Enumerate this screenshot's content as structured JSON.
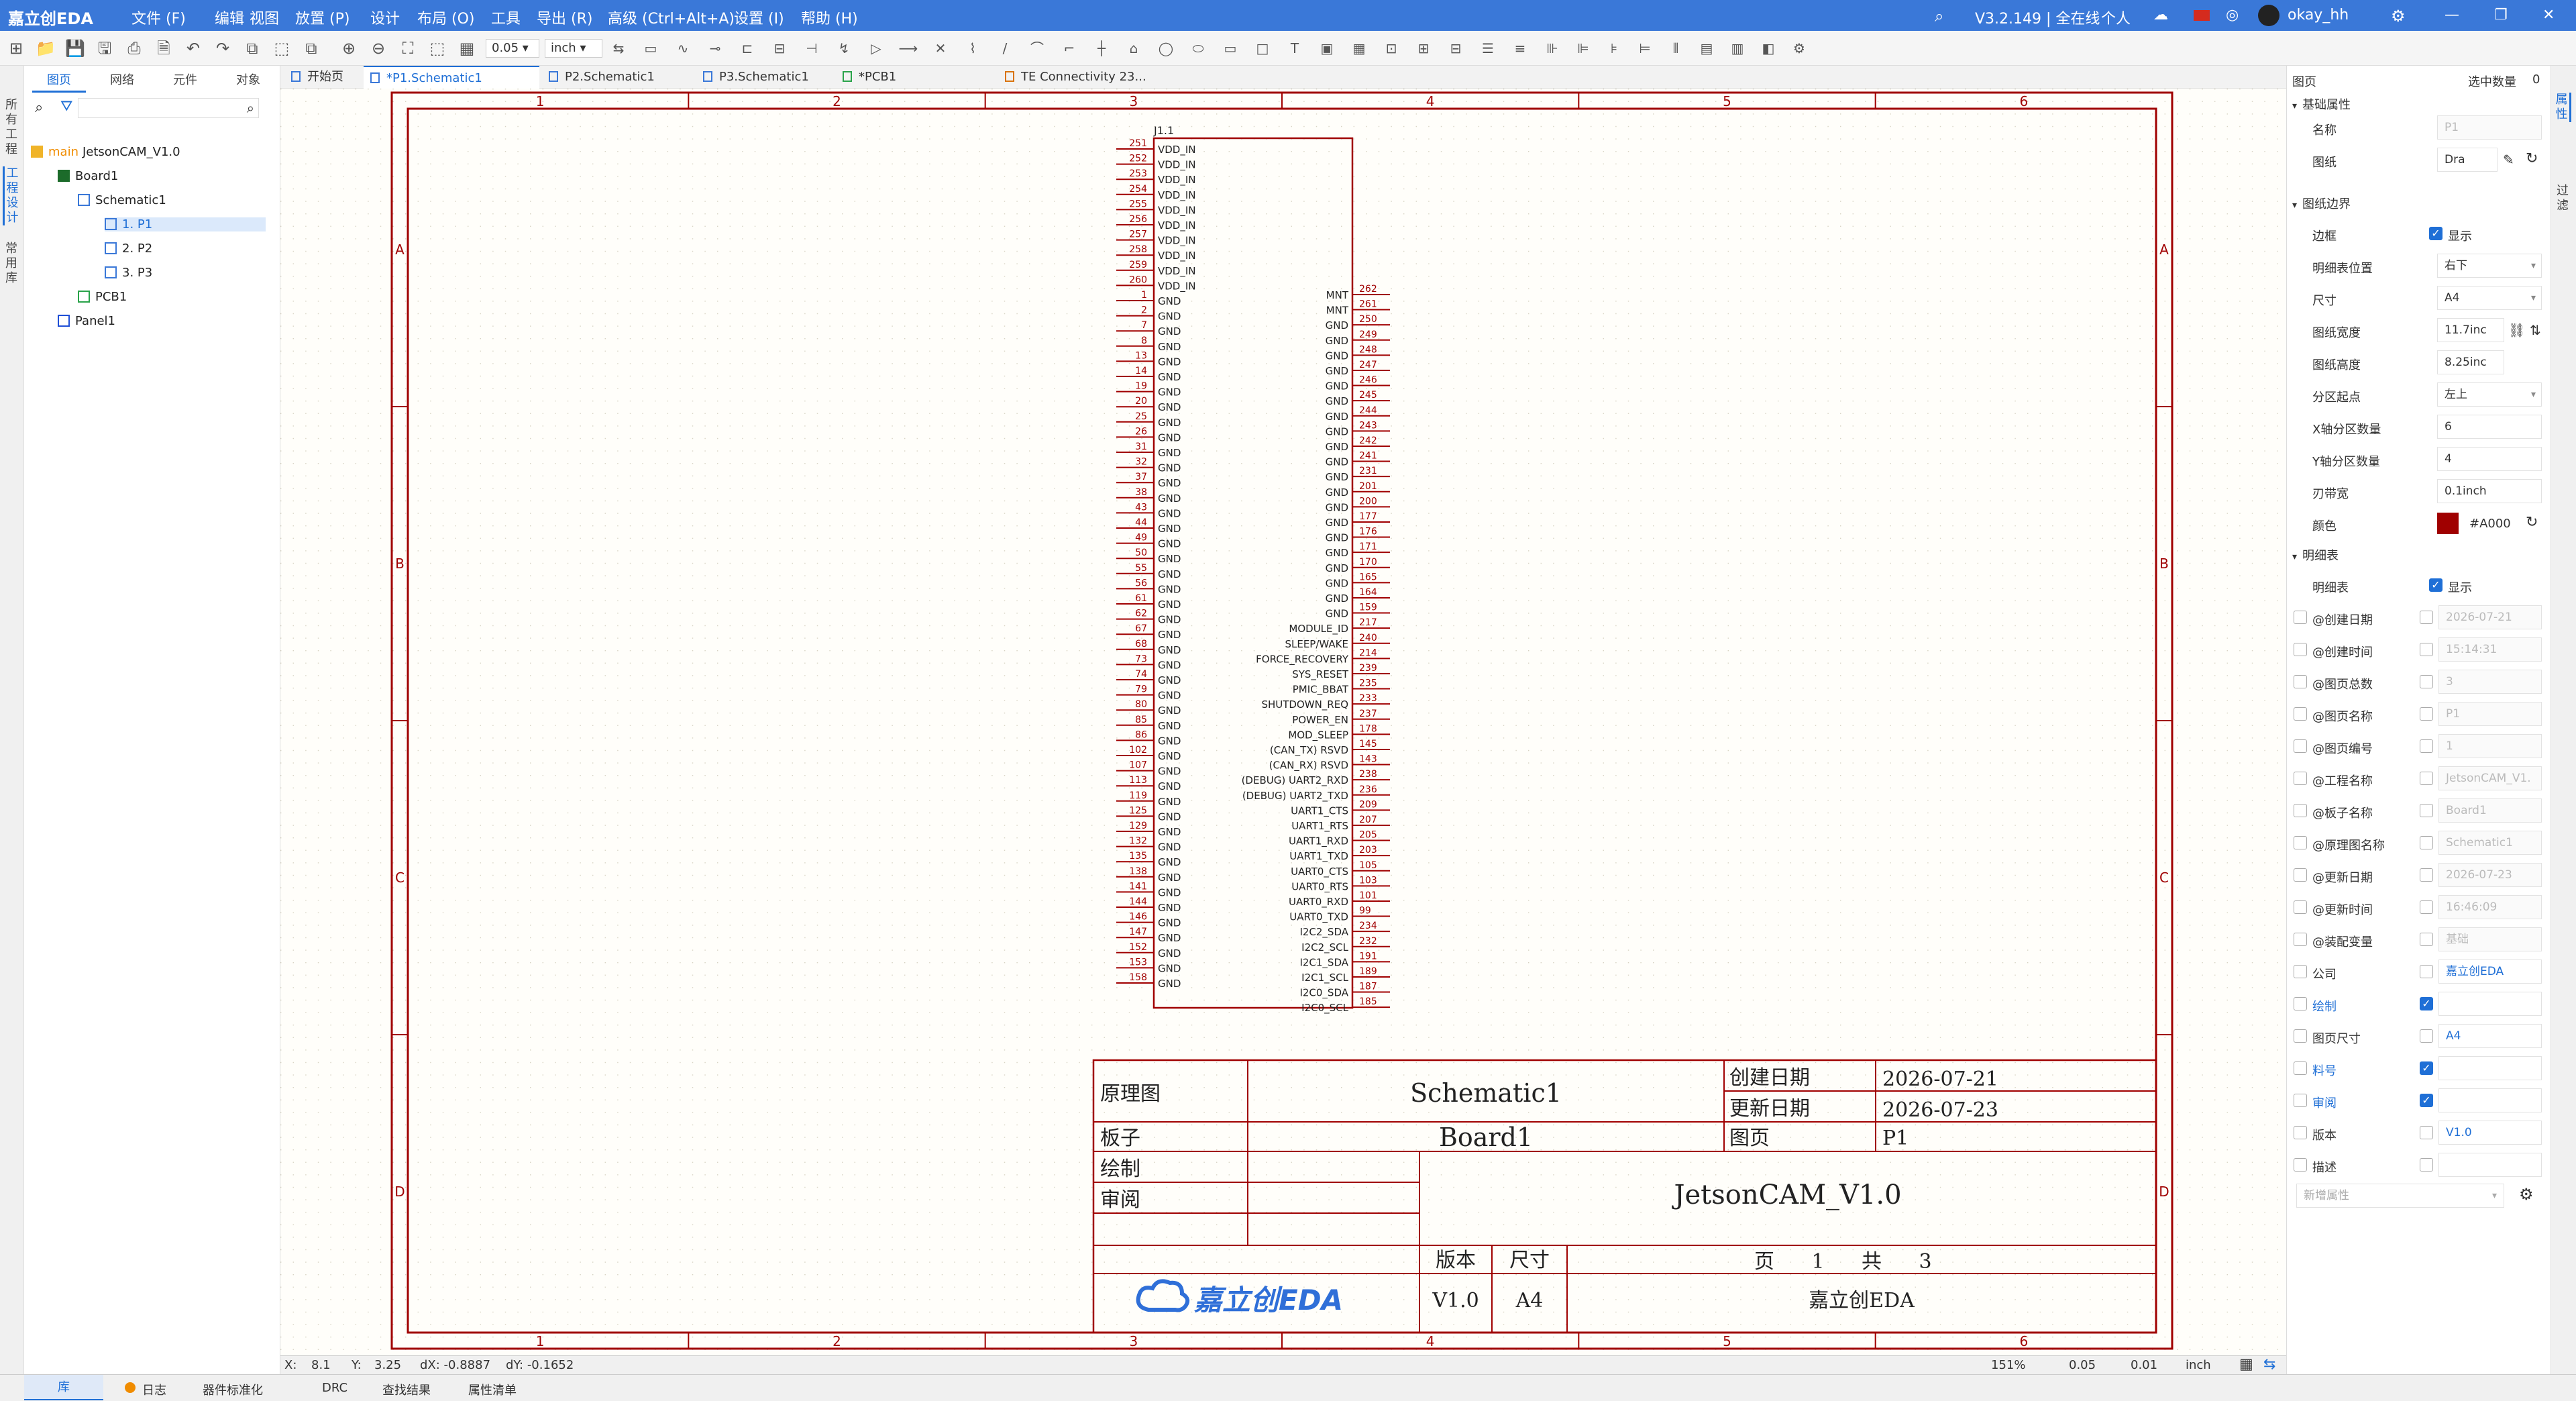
{
  "app": {
    "logo": "嘉立创EDA",
    "version": "V3.2.149 | 全在线",
    "personal": "个人",
    "user": "okay_hh"
  },
  "menu": [
    "文件 (F)",
    "编辑",
    "视图",
    "放置 (P)",
    "设计",
    "布局 (O)",
    "工具",
    "导出 (R)",
    "高级 (Ctrl+Alt+A)",
    "设置 (I)",
    "帮助 (H)"
  ],
  "toolbar": {
    "grid": "0.05",
    "unit": "inch"
  },
  "left_strip": {
    "tabs": [
      "所有工程",
      "工程设计",
      "常用库"
    ]
  },
  "left_panel": {
    "tabs": [
      "图页",
      "网络",
      "元件",
      "对象"
    ],
    "tree": [
      {
        "label": "JetsonCAM_V1.0",
        "branch": "main",
        "icon": "folder-icon"
      },
      {
        "label": "Board1",
        "icon": "board-icon"
      },
      {
        "label": "Schematic1",
        "icon": "schematic-icon"
      },
      {
        "label": "1. P1",
        "icon": "page-icon"
      },
      {
        "label": "2. P2",
        "icon": "page-icon"
      },
      {
        "label": "3. P3",
        "icon": "page-icon"
      },
      {
        "label": "PCB1",
        "icon": "pcb-icon"
      },
      {
        "label": "Panel1",
        "icon": "panel-icon"
      }
    ]
  },
  "doc_tabs": [
    "开始页",
    "*P1.Schematic1",
    "P2.Schematic1",
    "P3.Schematic1",
    "*PCB1",
    "TE Connectivity 23..."
  ],
  "schematic": {
    "zone_cols": [
      "1",
      "2",
      "3",
      "4",
      "5",
      "6"
    ],
    "zone_rows": [
      "A",
      "B",
      "C",
      "D"
    ],
    "designator": "J1.1",
    "left_pins": [
      [
        "251",
        "VDD_IN"
      ],
      [
        "252",
        "VDD_IN"
      ],
      [
        "253",
        "VDD_IN"
      ],
      [
        "254",
        "VDD_IN"
      ],
      [
        "255",
        "VDD_IN"
      ],
      [
        "256",
        "VDD_IN"
      ],
      [
        "257",
        "VDD_IN"
      ],
      [
        "258",
        "VDD_IN"
      ],
      [
        "259",
        "VDD_IN"
      ],
      [
        "260",
        "VDD_IN"
      ],
      [
        "1",
        "GND"
      ],
      [
        "2",
        "GND"
      ],
      [
        "7",
        "GND"
      ],
      [
        "8",
        "GND"
      ],
      [
        "13",
        "GND"
      ],
      [
        "14",
        "GND"
      ],
      [
        "19",
        "GND"
      ],
      [
        "20",
        "GND"
      ],
      [
        "25",
        "GND"
      ],
      [
        "26",
        "GND"
      ],
      [
        "31",
        "GND"
      ],
      [
        "32",
        "GND"
      ],
      [
        "37",
        "GND"
      ],
      [
        "38",
        "GND"
      ],
      [
        "43",
        "GND"
      ],
      [
        "44",
        "GND"
      ],
      [
        "49",
        "GND"
      ],
      [
        "50",
        "GND"
      ],
      [
        "55",
        "GND"
      ],
      [
        "56",
        "GND"
      ],
      [
        "61",
        "GND"
      ],
      [
        "62",
        "GND"
      ],
      [
        "67",
        "GND"
      ],
      [
        "68",
        "GND"
      ],
      [
        "73",
        "GND"
      ],
      [
        "74",
        "GND"
      ],
      [
        "79",
        "GND"
      ],
      [
        "80",
        "GND"
      ],
      [
        "85",
        "GND"
      ],
      [
        "86",
        "GND"
      ],
      [
        "102",
        "GND"
      ],
      [
        "107",
        "GND"
      ],
      [
        "113",
        "GND"
      ],
      [
        "119",
        "GND"
      ],
      [
        "125",
        "GND"
      ],
      [
        "129",
        "GND"
      ],
      [
        "132",
        "GND"
      ],
      [
        "135",
        "GND"
      ],
      [
        "138",
        "GND"
      ],
      [
        "141",
        "GND"
      ],
      [
        "144",
        "GND"
      ],
      [
        "146",
        "GND"
      ],
      [
        "147",
        "GND"
      ],
      [
        "152",
        "GND"
      ],
      [
        "153",
        "GND"
      ],
      [
        "158",
        "GND"
      ]
    ],
    "right_pins": [
      [
        "262",
        "MNT"
      ],
      [
        "261",
        "MNT"
      ],
      [
        "250",
        "GND"
      ],
      [
        "249",
        "GND"
      ],
      [
        "248",
        "GND"
      ],
      [
        "247",
        "GND"
      ],
      [
        "246",
        "GND"
      ],
      [
        "245",
        "GND"
      ],
      [
        "244",
        "GND"
      ],
      [
        "243",
        "GND"
      ],
      [
        "242",
        "GND"
      ],
      [
        "241",
        "GND"
      ],
      [
        "231",
        "GND"
      ],
      [
        "201",
        "GND"
      ],
      [
        "200",
        "GND"
      ],
      [
        "177",
        "GND"
      ],
      [
        "176",
        "GND"
      ],
      [
        "171",
        "GND"
      ],
      [
        "170",
        "GND"
      ],
      [
        "165",
        "GND"
      ],
      [
        "164",
        "GND"
      ],
      [
        "159",
        "GND"
      ],
      [
        "217",
        "MODULE_ID"
      ],
      [
        "240",
        "SLEEP/WAKE"
      ],
      [
        "214",
        "FORCE_RECOVERY"
      ],
      [
        "239",
        "SYS_RESET"
      ],
      [
        "235",
        "PMIC_BBAT"
      ],
      [
        "233",
        "SHUTDOWN_REQ"
      ],
      [
        "237",
        "POWER_EN"
      ],
      [
        "178",
        "MOD_SLEEP"
      ],
      [
        "145",
        "(CAN_TX) RSVD"
      ],
      [
        "143",
        "(CAN_RX) RSVD"
      ],
      [
        "238",
        "(DEBUG) UART2_RXD"
      ],
      [
        "236",
        "(DEBUG) UART2_TXD"
      ],
      [
        "209",
        "UART1_CTS"
      ],
      [
        "207",
        "UART1_RTS"
      ],
      [
        "205",
        "UART1_RXD"
      ],
      [
        "203",
        "UART1_TXD"
      ],
      [
        "105",
        "UART0_CTS"
      ],
      [
        "103",
        "UART0_RTS"
      ],
      [
        "101",
        "UART0_RXD"
      ],
      [
        "99",
        "UART0_TXD"
      ],
      [
        "234",
        "I2C2_SDA"
      ],
      [
        "232",
        "I2C2_SCL"
      ],
      [
        "191",
        "I2C1_SDA"
      ],
      [
        "189",
        "I2C1_SCL"
      ],
      [
        "187",
        "I2C0_SDA"
      ],
      [
        "185",
        "I2C0_SCL"
      ]
    ],
    "title_block": {
      "type_label": "原理图",
      "schematic_name": "Schematic1",
      "create_label": "创建日期",
      "create_date": "2026-07-21",
      "update_label": "更新日期",
      "update_date": "2026-07-23",
      "board_label": "板子",
      "board_name": "Board1",
      "page_label": "图页",
      "page_name": "P1",
      "drawn_label": "绘制",
      "review_label": "审阅",
      "project": "JetsonCAM_V1.0",
      "version_label": "版本",
      "size_label": "尺寸",
      "page_word": "页",
      "page_num": "1",
      "total_word": "共",
      "total_num": "3",
      "version": "V1.0",
      "size": "A4",
      "company": "嘉立创EDA",
      "logo": "嘉立创EDA"
    }
  },
  "status_bar": {
    "x_label": "X:",
    "x": "8.1",
    "y_label": "Y:",
    "y": "3.25",
    "dx": "dX: -0.8887",
    "dy": "dY: -0.1652",
    "zoom": "151%",
    "grid": "0.05",
    "snap": "0.01",
    "unit": "inch"
  },
  "bottom_tabs": [
    "库",
    "日志",
    "器件标准化",
    "DRC",
    "查找结果",
    "属性清单"
  ],
  "right_panel": {
    "title": "图页",
    "selected_label": "选中数量",
    "selected_count": "0",
    "basic_section": "基础属性",
    "name_label": "名称",
    "name_value": "P1",
    "drawing_label": "图纸",
    "drawing_value": "Dra",
    "border_section": "图纸边界",
    "border_label": "边框",
    "border_show": "显示",
    "title_pos_label": "明细表位置",
    "title_pos": "右下",
    "size_label": "尺寸",
    "size": "A4",
    "width_label": "图纸宽度",
    "width": "11.7inc",
    "height_label": "图纸高度",
    "height": "8.25inc",
    "origin_label": "分区起点",
    "origin": "左上",
    "xdiv_label": "X轴分区数量",
    "xdiv": "6",
    "ydiv_label": "Y轴分区数量",
    "ydiv": "4",
    "edge_label": "刃带宽",
    "edge": "0.1inch",
    "color_label": "颜色",
    "color": "#A000",
    "color_swatch": "#a00000",
    "tb_section": "明细表",
    "tb_label": "明细表",
    "tb_show": "显示",
    "fields": [
      {
        "label": "@创建日期",
        "value": "2026-07-21",
        "check": false,
        "show": false,
        "disabled": true
      },
      {
        "label": "@创建时间",
        "value": "15:14:31",
        "check": false,
        "show": false,
        "disabled": true
      },
      {
        "label": "@图页总数",
        "value": "3",
        "check": false,
        "show": false,
        "disabled": true
      },
      {
        "label": "@图页名称",
        "value": "P1",
        "check": false,
        "show": false,
        "disabled": true
      },
      {
        "label": "@图页编号",
        "value": "1",
        "check": false,
        "show": false,
        "disabled": true
      },
      {
        "label": "@工程名称",
        "value": "JetsonCAM_V1.",
        "check": false,
        "show": false,
        "disabled": true
      },
      {
        "label": "@板子名称",
        "value": "Board1",
        "check": false,
        "show": false,
        "disabled": true
      },
      {
        "label": "@原理图名称",
        "value": "Schematic1",
        "check": false,
        "show": false,
        "disabled": true
      },
      {
        "label": "@更新日期",
        "value": "2026-07-23",
        "check": false,
        "show": false,
        "disabled": true
      },
      {
        "label": "@更新时间",
        "value": "16:46:09",
        "check": false,
        "show": false,
        "disabled": true
      },
      {
        "label": "@装配变量",
        "value": "基础",
        "check": false,
        "show": false,
        "disabled": true
      },
      {
        "label": "公司",
        "value": "嘉立创EDA",
        "check": false,
        "show": false,
        "disabled": false,
        "blue": true
      },
      {
        "label": "绘制",
        "value": "",
        "check": false,
        "show": true,
        "disabled": false,
        "blue_label": true
      },
      {
        "label": "图页尺寸",
        "value": "A4",
        "check": false,
        "show": false,
        "disabled": false,
        "blue": true
      },
      {
        "label": "料号",
        "value": "",
        "check": false,
        "show": true,
        "disabled": false,
        "blue_label": true
      },
      {
        "label": "审阅",
        "value": "",
        "check": false,
        "show": true,
        "disabled": false,
        "blue_label": true
      },
      {
        "label": "版本",
        "value": "V1.0",
        "check": false,
        "show": false,
        "disabled": false,
        "blue": true
      },
      {
        "label": "描述",
        "value": "",
        "check": false,
        "show": false,
        "disabled": false
      }
    ],
    "new_attr": "新增属性"
  },
  "right_strip": {
    "tabs": [
      "属性",
      "过滤"
    ]
  },
  "colors": {
    "accent": "#3a78d8",
    "border_red": "#a00000",
    "text_blue": "#1f6fd6"
  }
}
